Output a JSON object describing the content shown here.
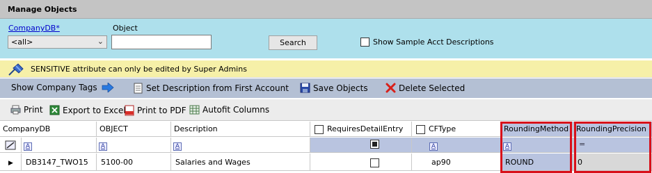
{
  "window": {
    "title": "Manage Objects"
  },
  "filters": {
    "companydb_label": "CompanyDB*",
    "companydb_value": "<all>",
    "object_label": "Object",
    "object_value": "",
    "search_label": "Search",
    "show_sample_label": "Show Sample Acct Descriptions"
  },
  "warning": {
    "text": "SENSITIVE attribute can only be edited by Super Admins"
  },
  "actions": {
    "show_tags": "Show Company Tags",
    "set_desc": "Set Description from First Account",
    "save": "Save Objects",
    "delete": "Delete Selected"
  },
  "toolbar": {
    "print": "Print",
    "export": "Export to Excel",
    "print_pdf": "Print to PDF",
    "autofit": "Autofit Columns"
  },
  "grid": {
    "columns": {
      "companydb": "CompanyDB",
      "object": "OBJECT",
      "description": "Description",
      "requires": "RequiresDetailEntry",
      "cftype": "CFType",
      "rounding_method": "RoundingMethod",
      "rounding_precision": "RoundingPrecision"
    },
    "filter_eq": "=",
    "row": {
      "companydb": "DB3147_TWO15",
      "object": "5100-00",
      "description": "Salaries and Wages",
      "cftype": "ap90",
      "rounding_method": "ROUND",
      "rounding_precision": "0"
    }
  },
  "colors": {
    "highlight": "#d8101a",
    "selected": "#b9c4e0"
  }
}
